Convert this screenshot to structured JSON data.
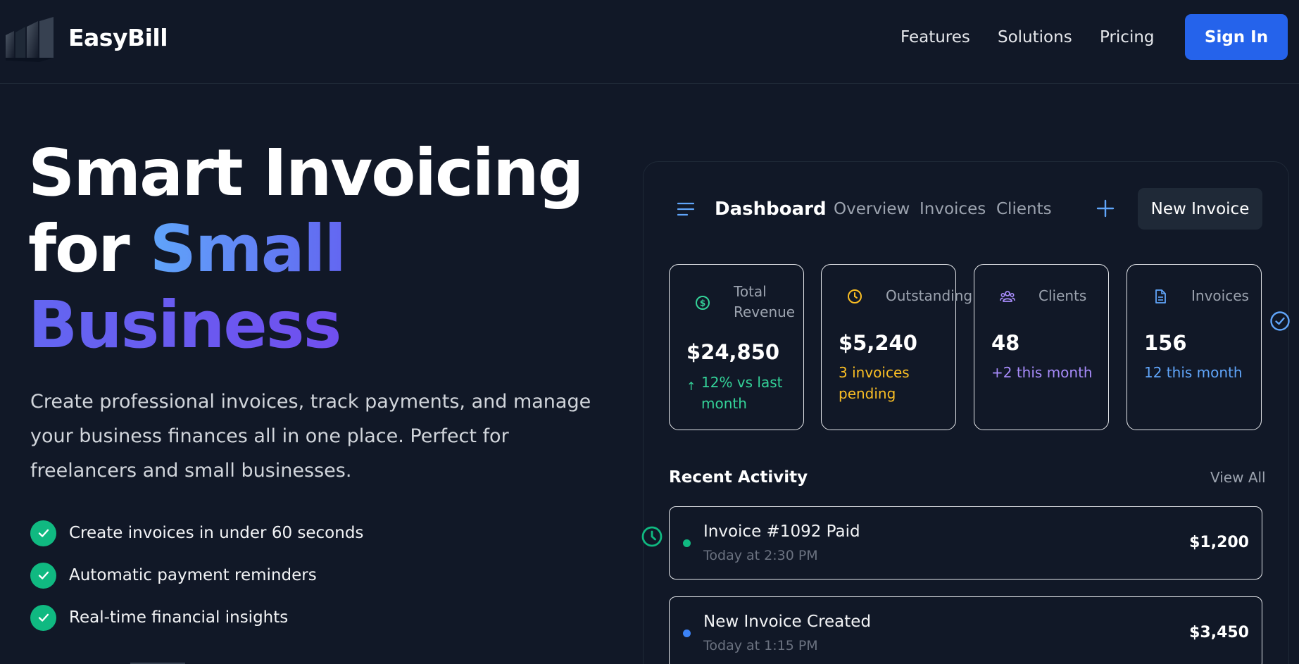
{
  "header": {
    "brand": "EasyBill",
    "nav": [
      "Features",
      "Solutions",
      "Pricing"
    ],
    "signin_label": "Sign In"
  },
  "hero": {
    "title_part1": "Smart Invoicing",
    "title_part2": "for",
    "title_part3": "Small",
    "title_part4": "Business",
    "description": "Create professional invoices, track payments, and manage your business finances all in one place. Perfect for freelancers and small businesses.",
    "features": [
      "Create invoices in under 60 seconds",
      "Automatic payment reminders",
      "Real-time financial insights"
    ]
  },
  "dashboard": {
    "title": "Dashboard",
    "tabs": [
      "Overview",
      "Invoices",
      "Clients"
    ],
    "new_invoice_label": "New Invoice",
    "stats": [
      {
        "label": "Total Revenue",
        "value": "$24,850",
        "sub": "12% vs last month",
        "sub_arrow": "↑",
        "icon": "dollar-circle-icon",
        "color": "#34d399"
      },
      {
        "label": "Outstanding",
        "value": "$5,240",
        "sub": "3 invoices pending",
        "icon": "clock-icon",
        "color": "#fbbf24"
      },
      {
        "label": "Clients",
        "value": "48",
        "sub": "+2 this month",
        "icon": "users-icon",
        "color": "#a78bfa"
      },
      {
        "label": "Invoices",
        "value": "156",
        "sub": "12 this month",
        "icon": "document-icon",
        "color": "#60a5fa"
      }
    ],
    "recent_activity_title": "Recent Activity",
    "view_all_label": "View All",
    "activity": [
      {
        "name": "Invoice #1092 Paid",
        "time": "Today at 2:30 PM",
        "amount": "$1,200",
        "dot_color": "#10b981"
      },
      {
        "name": "New Invoice Created",
        "time": "Today at 1:15 PM",
        "amount": "$3,450",
        "dot_color": "#3b82f6"
      }
    ]
  },
  "colors": {
    "background": "#111827",
    "accent": "#2563eb",
    "success": "#10b981"
  }
}
